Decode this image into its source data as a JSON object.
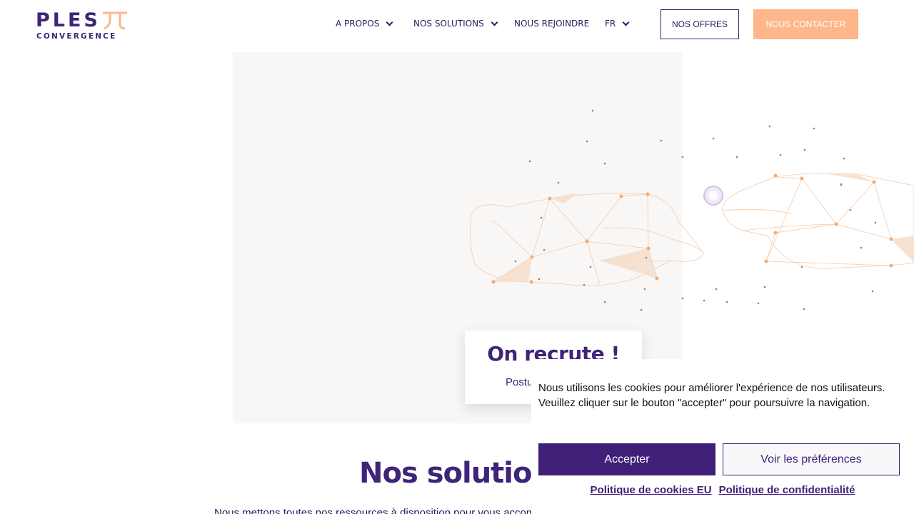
{
  "brand": {
    "logo_word": "PLES",
    "logo_sub": "CONVERGENCE",
    "colors": {
      "primary": "#3f2478",
      "accent": "#fdb78a",
      "hero_bg": "#f8f7f6"
    }
  },
  "nav": {
    "items": [
      {
        "label": "A PROPOS",
        "has_dropdown": true
      },
      {
        "label": "NOS SOLUTIONS",
        "has_dropdown": true
      },
      {
        "label": "NOUS REJOINDRE",
        "has_dropdown": false
      },
      {
        "label": "FR",
        "has_dropdown": true
      }
    ],
    "offres_label": "NOS OFFRES",
    "contact_label": "NOUS CONTACTER"
  },
  "hero": {
    "recruit_title": "On recrute !",
    "recruit_sub": "Postu"
  },
  "solutions": {
    "title": "Nos solutior",
    "text": "Nous mettons toutes nos ressources à disposition pour vous accompagner au mieux !"
  },
  "cookie": {
    "message": "Nous utilisons les cookies pour améliorer l'expérience de nos utilisateurs. Veuillez cliquer sur le bouton \"accepter\" pour poursuivre la navigation.",
    "accept_label": "Accepter",
    "prefs_label": "Voir les préférences",
    "links": [
      "Politique de cookies EU",
      "Politique de confidentialité"
    ]
  }
}
